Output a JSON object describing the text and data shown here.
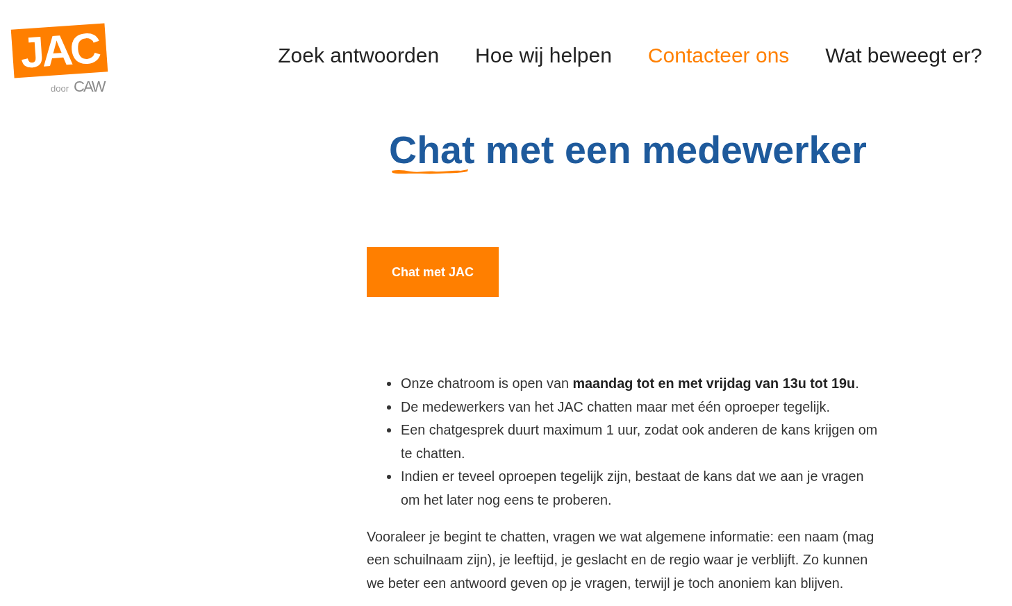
{
  "logo": {
    "mark": "JAC",
    "byline": "door",
    "partner": "CAW"
  },
  "nav": [
    {
      "label": "Zoek antwoorden",
      "selected": false
    },
    {
      "label": "Hoe wij helpen",
      "selected": false
    },
    {
      "label": "Contacteer ons",
      "selected": true
    },
    {
      "label": "Wat beweegt er?",
      "selected": false
    }
  ],
  "page": {
    "title": "Chat met een medewerker",
    "button": "Chat met JAC",
    "list_items": [
      "Onze chatroom is open van **maandag tot en met vrijdag van 13u tot 19u**.",
      "De medewerkers van het JAC chatten maar met één oproeper tegelijk.",
      "Een chatgesprek duurt maximum 1 uur, zodat ook anderen de kans krijgen om te chatten.",
      "Indien er teveel oproepen tegelijk zijn, bestaat de kans dat we aan je vragen om het later nog eens te proberen."
    ],
    "paragraph": "Vooraleer je begint te chatten, vragen we wat algemene informatie: een naam (mag een schuilnaam zijn), je leeftijd, je geslacht en de regio waar je verblijft. Zo kunnen we beter een antwoord geven op je vragen, terwijl je toch anoniem kan blijven."
  }
}
